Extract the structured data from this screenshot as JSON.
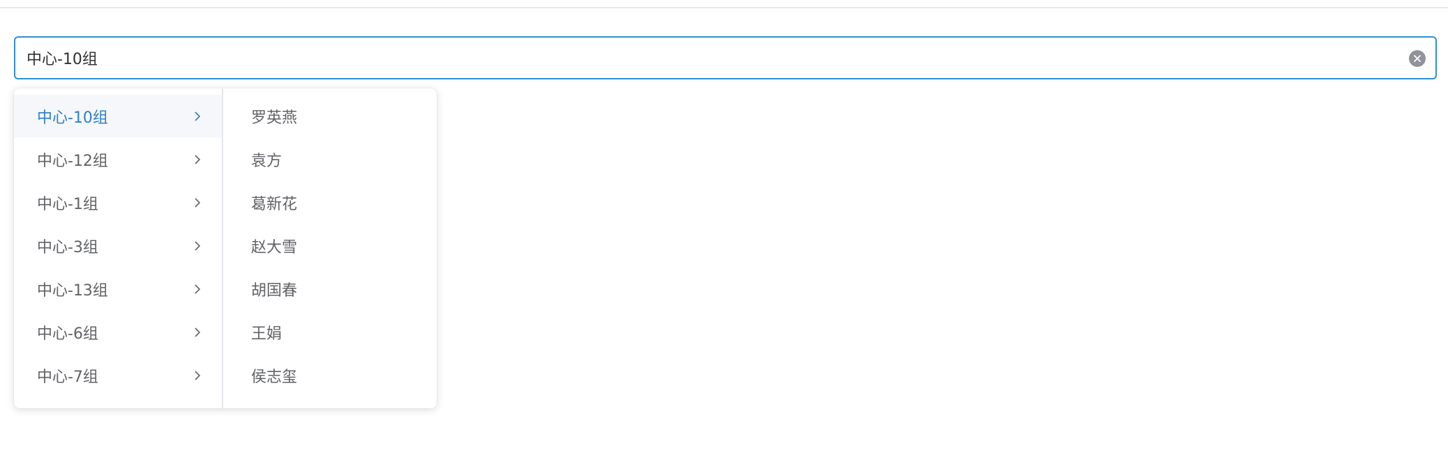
{
  "cascader": {
    "value": "中心-10组"
  },
  "groups": [
    {
      "label": "中心-10组",
      "active": true
    },
    {
      "label": "中心-12组",
      "active": false
    },
    {
      "label": "中心-1组",
      "active": false
    },
    {
      "label": "中心-3组",
      "active": false
    },
    {
      "label": "中心-13组",
      "active": false
    },
    {
      "label": "中心-6组",
      "active": false
    },
    {
      "label": "中心-7组",
      "active": false
    }
  ],
  "members": [
    {
      "label": "罗英燕"
    },
    {
      "label": "袁方"
    },
    {
      "label": "葛新花"
    },
    {
      "label": "赵大雪"
    },
    {
      "label": "胡国春"
    },
    {
      "label": "王娟"
    },
    {
      "label": "侯志玺"
    }
  ],
  "colors": {
    "accent": "#2f7fc2",
    "border_focus": "#2e8fd6",
    "text": "#606266",
    "active_bg": "#f5f7fa"
  },
  "icons": {
    "clear": "circle-close-icon",
    "expand": "chevron-right-icon"
  }
}
